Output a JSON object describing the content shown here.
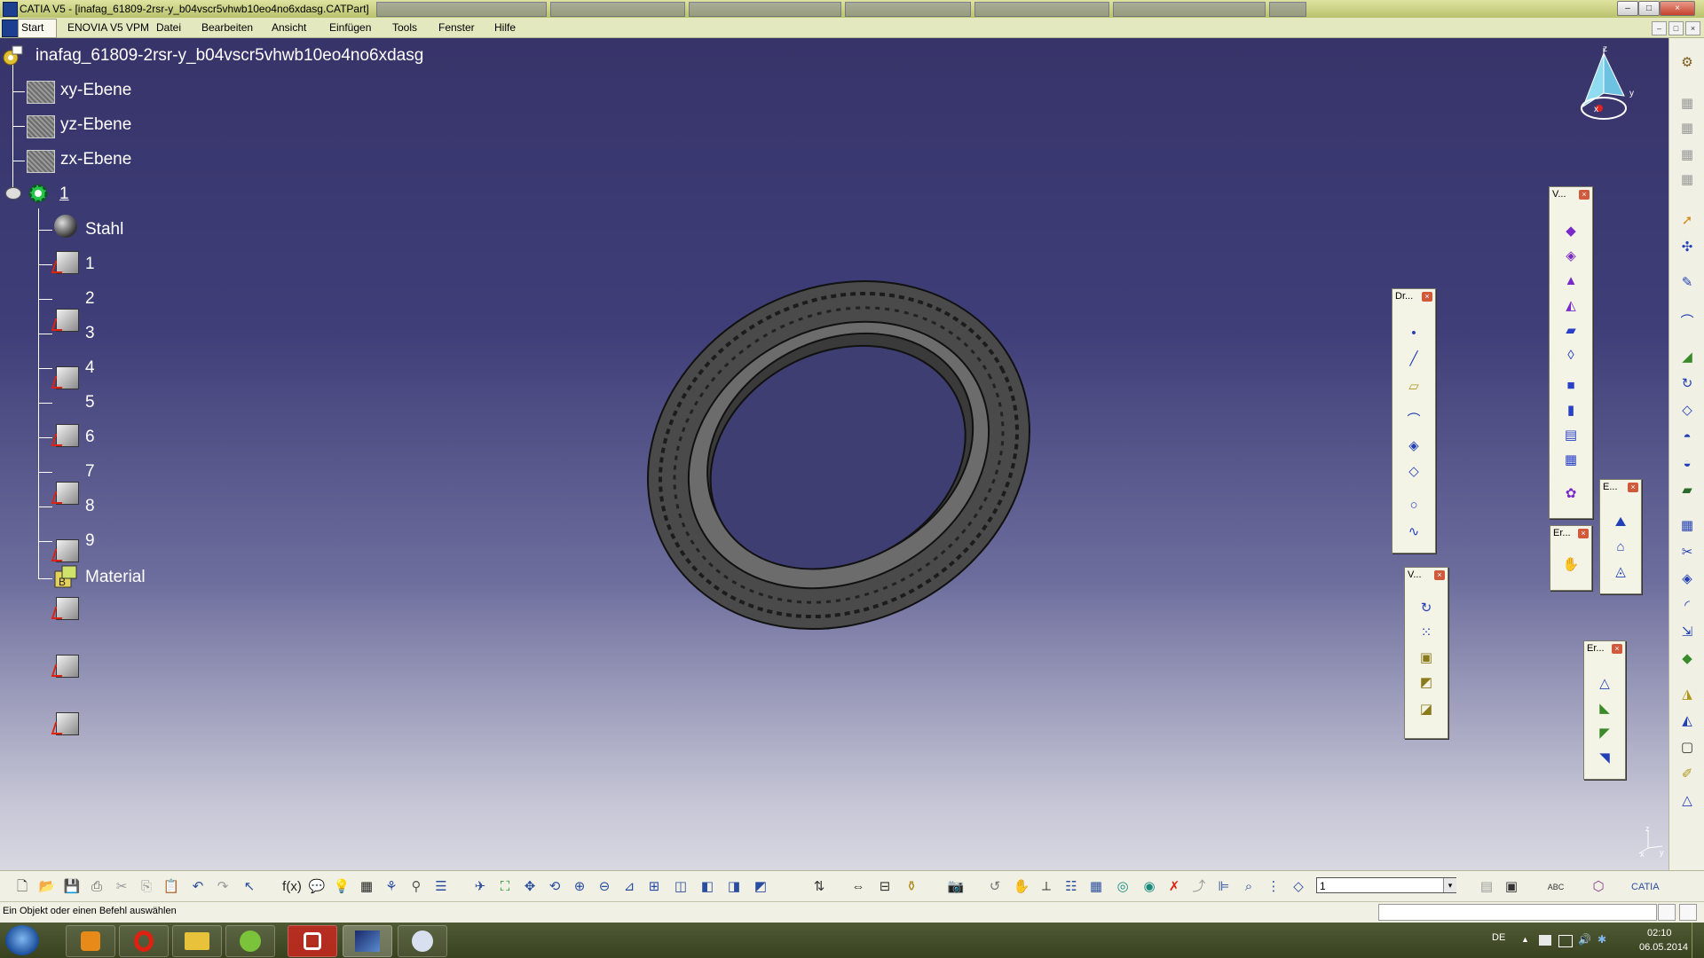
{
  "window": {
    "title": "CATIA V5 - [inafag_61809-2rsr-y_b04vscr5vhwb10eo4no6xdasg.CATPart]",
    "buttons": {
      "minimize": "–",
      "maximize": "□",
      "close": "×"
    }
  },
  "menu": {
    "items": [
      "Start",
      "ENOVIA V5 VPM",
      "Datei",
      "Bearbeiten",
      "Ansicht",
      "Einfügen",
      "Tools",
      "Fenster",
      "Hilfe"
    ]
  },
  "tree": {
    "root": "inafag_61809-2rsr-y_b04vscr5vhwb10eo4no6xdasg",
    "planes": [
      "xy-Ebene",
      "yz-Ebene",
      "zx-Ebene"
    ],
    "part_body": "1",
    "material_child": "Stahl",
    "bodies": [
      "1",
      "2",
      "3",
      "4",
      "5",
      "6",
      "7",
      "8",
      "9"
    ],
    "material": "Material"
  },
  "compass": {
    "x": "x",
    "y": "y",
    "z": "z"
  },
  "floating_toolbars": {
    "draft": "Dr...",
    "volumes_top": "V...",
    "volumes_bottom": "V...",
    "extract": "E...",
    "er_small": "Er...",
    "er_lower": "Er..."
  },
  "axis_mini": {
    "x": "x",
    "y": "y",
    "z": "z"
  },
  "bottom_toolbar": {
    "layer_value": "1",
    "abc_label": "ABC"
  },
  "status": {
    "message": "Ein Objekt oder einen Befehl auswählen"
  },
  "taskbar": {
    "language": "DE",
    "time": "02:10",
    "date": "06.05.2014"
  },
  "colors": {
    "background_top": "#37346a",
    "background_bottom": "#d8d8e2",
    "toolbar_bg": "#f0f1e4",
    "taskbar_bg": "#3f4a24"
  }
}
